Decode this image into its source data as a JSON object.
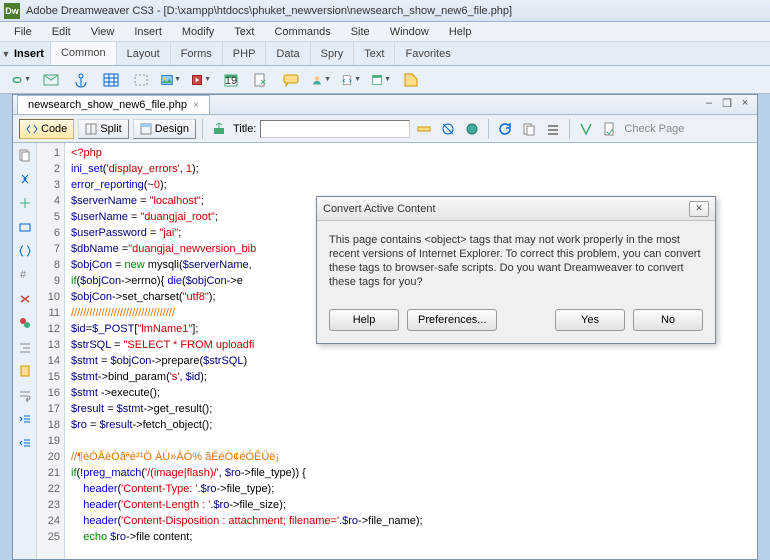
{
  "window": {
    "title": "Adobe Dreamweaver CS3 - [D:\\xampp\\htdocs\\phuket_newversion\\newsearch_show_new6_file.php]"
  },
  "menu": [
    "File",
    "Edit",
    "View",
    "Insert",
    "Modify",
    "Text",
    "Commands",
    "Site",
    "Window",
    "Help"
  ],
  "insert_bar": {
    "label": "Insert",
    "tabs": [
      "Common",
      "Layout",
      "Forms",
      "PHP",
      "Data",
      "Spry",
      "Text",
      "Favorites"
    ]
  },
  "doc": {
    "tab": "newsearch_show_new6_file.php",
    "views": {
      "code": "Code",
      "split": "Split",
      "design": "Design"
    },
    "title_label": "Title:",
    "title_value": "",
    "check_page": "Check Page"
  },
  "code": {
    "lines": [
      [
        {
          "c": "c-red",
          "t": "<?php"
        }
      ],
      [
        {
          "c": "c-blue",
          "t": "ini_set"
        },
        {
          "c": "c-black",
          "t": "("
        },
        {
          "c": "c-red",
          "t": "'display_errors'"
        },
        {
          "c": "c-black",
          "t": ", "
        },
        {
          "c": "c-red",
          "t": "1"
        },
        {
          "c": "c-black",
          "t": ");"
        }
      ],
      [
        {
          "c": "c-blue",
          "t": "error_reporting"
        },
        {
          "c": "c-black",
          "t": "(~"
        },
        {
          "c": "c-red",
          "t": "0"
        },
        {
          "c": "c-black",
          "t": ");"
        }
      ],
      [
        {
          "c": "c-navy",
          "t": "$serverName"
        },
        {
          "c": "c-black",
          "t": " = "
        },
        {
          "c": "c-red",
          "t": "\"localhost\""
        },
        {
          "c": "c-black",
          "t": ";"
        }
      ],
      [
        {
          "c": "c-navy",
          "t": "$userName"
        },
        {
          "c": "c-black",
          "t": " = "
        },
        {
          "c": "c-red",
          "t": "\"duangjai_root\""
        },
        {
          "c": "c-black",
          "t": ";"
        }
      ],
      [
        {
          "c": "c-navy",
          "t": "$userPassword"
        },
        {
          "c": "c-black",
          "t": " = "
        },
        {
          "c": "c-red",
          "t": "\"jai\""
        },
        {
          "c": "c-black",
          "t": ";"
        }
      ],
      [
        {
          "c": "c-navy",
          "t": "$dbName"
        },
        {
          "c": "c-black",
          "t": " ="
        },
        {
          "c": "c-red",
          "t": "\"duangjai_newversion_bib"
        }
      ],
      [
        {
          "c": "c-navy",
          "t": "$objCon"
        },
        {
          "c": "c-black",
          "t": " = "
        },
        {
          "c": "c-green",
          "t": "new"
        },
        {
          "c": "c-black",
          "t": " mysqli("
        },
        {
          "c": "c-navy",
          "t": "$serverName"
        },
        {
          "c": "c-black",
          "t": ","
        }
      ],
      [
        {
          "c": "c-green",
          "t": "if"
        },
        {
          "c": "c-black",
          "t": "("
        },
        {
          "c": "c-navy",
          "t": "$objCon"
        },
        {
          "c": "c-black",
          "t": "->errno){ "
        },
        {
          "c": "c-blue",
          "t": "die"
        },
        {
          "c": "c-black",
          "t": "("
        },
        {
          "c": "c-navy",
          "t": "$objCon"
        },
        {
          "c": "c-black",
          "t": "->e"
        }
      ],
      [
        {
          "c": "c-navy",
          "t": "$objCon"
        },
        {
          "c": "c-black",
          "t": "->set_charset("
        },
        {
          "c": "c-red",
          "t": "\"utf8\""
        },
        {
          "c": "c-black",
          "t": ");"
        }
      ],
      [
        {
          "c": "c-cmt",
          "t": "//////////////////////////////////"
        }
      ],
      [
        {
          "c": "c-navy",
          "t": "$id"
        },
        {
          "c": "c-black",
          "t": "="
        },
        {
          "c": "c-navy",
          "t": "$_POST"
        },
        {
          "c": "c-black",
          "t": "["
        },
        {
          "c": "c-red",
          "t": "\"lmName1\""
        },
        {
          "c": "c-black",
          "t": "];"
        }
      ],
      [
        {
          "c": "c-navy",
          "t": "$strSQL"
        },
        {
          "c": "c-black",
          "t": " = "
        },
        {
          "c": "c-red",
          "t": "\"SELECT * FROM uploadfi"
        }
      ],
      [
        {
          "c": "c-navy",
          "t": "$stmt"
        },
        {
          "c": "c-black",
          "t": " = "
        },
        {
          "c": "c-navy",
          "t": "$objCon"
        },
        {
          "c": "c-black",
          "t": "->prepare("
        },
        {
          "c": "c-navy",
          "t": "$strSQL"
        },
        {
          "c": "c-black",
          "t": ")"
        }
      ],
      [
        {
          "c": "c-navy",
          "t": "$stmt"
        },
        {
          "c": "c-black",
          "t": "->bind_param("
        },
        {
          "c": "c-red",
          "t": "'s'"
        },
        {
          "c": "c-black",
          "t": ", "
        },
        {
          "c": "c-navy",
          "t": "$id"
        },
        {
          "c": "c-black",
          "t": ");"
        }
      ],
      [
        {
          "c": "c-navy",
          "t": "$stmt"
        },
        {
          "c": "c-black",
          "t": " ->execute();"
        }
      ],
      [
        {
          "c": "c-navy",
          "t": "$result"
        },
        {
          "c": "c-black",
          "t": " = "
        },
        {
          "c": "c-navy",
          "t": "$stmt"
        },
        {
          "c": "c-black",
          "t": "->get_result();"
        }
      ],
      [
        {
          "c": "c-navy",
          "t": "$ro"
        },
        {
          "c": "c-black",
          "t": " = "
        },
        {
          "c": "c-navy",
          "t": "$result"
        },
        {
          "c": "c-black",
          "t": "->fetch_object();"
        }
      ],
      [
        {
          "c": "c-black",
          "t": ""
        }
      ],
      [
        {
          "c": "c-cmt",
          "t": "//¶éÒÂèÒãªè²¹Ö ÀÙ»ÀÓ% ãËéÒ¢éÓÊÜë¡"
        }
      ],
      [
        {
          "c": "c-green",
          "t": "if"
        },
        {
          "c": "c-black",
          "t": "(!"
        },
        {
          "c": "c-blue",
          "t": "preg_match"
        },
        {
          "c": "c-black",
          "t": "("
        },
        {
          "c": "c-red",
          "t": "'/(image|flash)/'"
        },
        {
          "c": "c-black",
          "t": ", "
        },
        {
          "c": "c-navy",
          "t": "$ro"
        },
        {
          "c": "c-black",
          "t": "->file_type)) {"
        }
      ],
      [
        {
          "c": "c-black",
          "t": "    "
        },
        {
          "c": "c-blue",
          "t": "header"
        },
        {
          "c": "c-black",
          "t": "("
        },
        {
          "c": "c-red",
          "t": "'Content-Type: '"
        },
        {
          "c": "c-black",
          "t": "."
        },
        {
          "c": "c-navy",
          "t": "$ro"
        },
        {
          "c": "c-black",
          "t": "->file_type);"
        }
      ],
      [
        {
          "c": "c-black",
          "t": "    "
        },
        {
          "c": "c-blue",
          "t": "header"
        },
        {
          "c": "c-black",
          "t": "("
        },
        {
          "c": "c-red",
          "t": "'Content-Length : '"
        },
        {
          "c": "c-black",
          "t": "."
        },
        {
          "c": "c-navy",
          "t": "$ro"
        },
        {
          "c": "c-black",
          "t": "->file_size);"
        }
      ],
      [
        {
          "c": "c-black",
          "t": "    "
        },
        {
          "c": "c-blue",
          "t": "header"
        },
        {
          "c": "c-black",
          "t": "("
        },
        {
          "c": "c-red",
          "t": "'Content-Disposition : attachment; filename='"
        },
        {
          "c": "c-black",
          "t": "."
        },
        {
          "c": "c-navy",
          "t": "$ro"
        },
        {
          "c": "c-black",
          "t": "->file_name);"
        }
      ],
      [
        {
          "c": "c-black",
          "t": "    "
        },
        {
          "c": "c-green",
          "t": "echo"
        },
        {
          "c": "c-black",
          "t": " "
        },
        {
          "c": "c-navy",
          "t": "$ro"
        },
        {
          "c": "c-black",
          "t": "->file content;"
        }
      ]
    ]
  },
  "dialog": {
    "title": "Convert Active Content",
    "body": "This page contains <object> tags that may not work properly in the most recent versions of Internet Explorer. To correct this problem, you can convert these tags to browser-safe scripts. Do you want Dreamweaver to convert these tags for you?",
    "buttons": {
      "help": "Help",
      "prefs": "Preferences...",
      "yes": "Yes",
      "no": "No"
    }
  }
}
